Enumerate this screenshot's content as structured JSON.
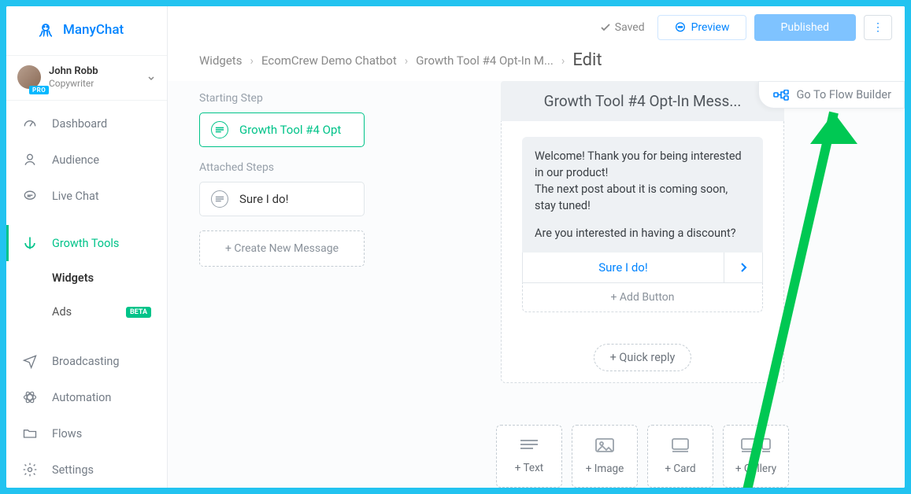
{
  "brand": {
    "name": "ManyChat"
  },
  "user": {
    "name": "John Robb",
    "role": "Copywriter",
    "badge": "PRO"
  },
  "nav": {
    "dashboard": "Dashboard",
    "audience": "Audience",
    "livechat": "Live Chat",
    "growthtools": "Growth Tools",
    "widgets": "Widgets",
    "ads": "Ads",
    "ads_badge": "BETA",
    "broadcasting": "Broadcasting",
    "automation": "Automation",
    "flows": "Flows",
    "settings": "Settings"
  },
  "topbar": {
    "saved": "Saved",
    "preview": "Preview",
    "published": "Published",
    "more": "⋮"
  },
  "crumbs": {
    "c1": "Widgets",
    "c2": "EcomCrew Demo Chatbot",
    "c3": "Growth Tool #4 Opt-In M...",
    "current": "Edit"
  },
  "steps": {
    "starting_heading": "Starting Step",
    "starting_label": "Growth Tool #4 Opt",
    "attached_heading": "Attached Steps",
    "attached_label": "Sure I do!",
    "create": "+ Create New Message"
  },
  "editor": {
    "title": "Growth Tool #4 Opt-In Mess...",
    "bubble_line1": "Welcome! Thank you for being interested in our product!",
    "bubble_line2": "The next post about it is coming soon, stay tuned!",
    "bubble_line3": "Are you interested in having a discount?",
    "button1": "Sure I do!",
    "add_button": "+ Add Button",
    "quick_reply": "+ Quick reply"
  },
  "picker": {
    "text": "+ Text",
    "image": "+ Image",
    "card": "+ Card",
    "gallery": "+ Gallery"
  },
  "flowbuilder": {
    "label": "Go To Flow Builder"
  }
}
